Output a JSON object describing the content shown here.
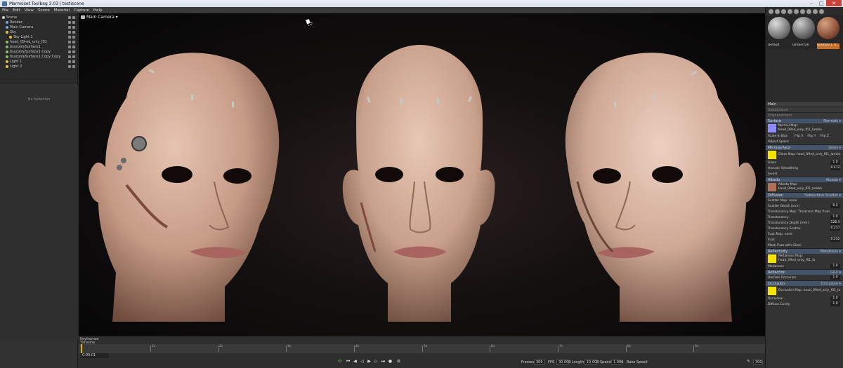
{
  "window": {
    "title": "Marmoset Toolbag 3.03 | testiscene"
  },
  "menu": [
    "File",
    "Edit",
    "View",
    "Scene",
    "Material",
    "Capture",
    "Help"
  ],
  "outliner": {
    "items": [
      {
        "label": "Scene",
        "indent": 0,
        "color": "#d0d0d0"
      },
      {
        "label": "Render",
        "indent": 1,
        "color": "#6fa8dc"
      },
      {
        "label": "Main Camera",
        "indent": 1,
        "color": "#6fa8dc"
      },
      {
        "label": "Sky",
        "indent": 1,
        "color": "#e6c14a"
      },
      {
        "label": "Sky Light 1",
        "indent": 2,
        "color": "#e6c14a"
      },
      {
        "label": "head_09-ed_only_f01",
        "indent": 1,
        "color": "#8fbf6a"
      },
      {
        "label": "bsurpolySurface1",
        "indent": 1,
        "color": "#8fbf6a"
      },
      {
        "label": "bsurpolySurface1 Copy",
        "indent": 1,
        "color": "#8fbf6a"
      },
      {
        "label": "bsurpolySurface1 Copy Copy",
        "indent": 1,
        "color": "#8fbf6a"
      },
      {
        "label": "Light 1",
        "indent": 1,
        "color": "#e6c14a"
      },
      {
        "label": "Light 2",
        "indent": 1,
        "color": "#e6c14a"
      }
    ],
    "empty_label": "No Selection"
  },
  "viewport": {
    "camera_label": "Main Camera ▾"
  },
  "timeline": {
    "keyframes_label": "Keyframes",
    "timeline_label": "Timeline",
    "timecode": "0:00.01",
    "frames_label": "Frames",
    "frames_value": "300",
    "fps_label": "FPS",
    "fps_value": "30.000",
    "length_label": "Length",
    "length_value": "10.000",
    "speed_label": "Speed",
    "speed_value": "1.000",
    "bake_label": "Bake Speed",
    "end_frame": "300"
  },
  "materials": {
    "names": [
      "Default",
      "lambert26",
      "Untitled 1 Tr..."
    ]
  },
  "inspector": {
    "main": "Main",
    "subdivision": "Subdivision",
    "displacement": "Displacement",
    "surface": {
      "title": "Surface",
      "mode": "Normals ▾",
      "normal_map": "Normal Map: head_09ed_only_f01_lambe",
      "scale_bias": "Scale & Bias",
      "flip_x": "Flip X",
      "flip_y": "Flip Y",
      "flip_z": "Flip Z",
      "object_space": "Object Space"
    },
    "microsurface": {
      "title": "Microsurface",
      "mode": "Gloss ▾",
      "map": "Gloss Map: head_09ed_only_f01_lambe",
      "channel": "Channel ▾ G",
      "gloss_label": "Gloss",
      "gloss_value": "1.0",
      "horizon_label": "Horizon Smoothing",
      "horizon_value": "0.412",
      "invert": "Invert"
    },
    "albedo": {
      "title": "Albedo",
      "mode": "Albedo ▾",
      "map": "Albedo Map: head_09ed_only_f01_lambe",
      "color": "Color"
    },
    "diffusion": {
      "title": "Diffusion",
      "mode": "Subsurface Scatter ▾",
      "scatter_map": "Scatter Map: none",
      "scatter_depth_label": "Scatter Depth (mm)",
      "scatter_depth_value": "6.4",
      "trans_map": "Translucency Map: Thickness Map from",
      "translucency_label": "Translucency",
      "translucency_value": "1.0",
      "trans_depth_label": "Translucency Depth (mm)",
      "trans_depth_value": "128.4",
      "trans_scatter_label": "Translucency Scatter",
      "trans_scatter_value": "0.237",
      "fuzz_map": "Fuzz Map: none",
      "fuzz_label": "Fuzz",
      "fuzz_value": "0.232",
      "mask_fuzz": "Mask Fuzz with Gloss"
    },
    "reflectivity": {
      "title": "Reflectivity",
      "mode": "Metalness ▾",
      "map": "Metalness Map: head_09ed_only_f01_la",
      "channel": "Channel ▾ R",
      "metalness_label": "Metalness",
      "metalness_value": "1.0",
      "invert": "Invert"
    },
    "reflection": {
      "title": "Reflection",
      "mode": "GGX ▾",
      "horizon_label": "Horizon Occlusion",
      "horizon_value": "1.0",
      "secondary": "Secondary Reflection"
    },
    "occlusion": {
      "title": "Occlusion",
      "mode": "Occlusion ▾",
      "map": "Occlusion Map: head_09ed_only_f01_la",
      "channel": "Channel ▾ R",
      "occlusion_label": "Occlusion",
      "occlusion_value": "1.0",
      "uv_set": "UV Set ▾",
      "vertex_channel": "Vertex Channel ▾",
      "cavity_map": "Cavity Map: none",
      "cavity_channel": "Channel ▾ R",
      "diffuse_cavity_label": "Diffuse Cavity",
      "diffuse_cavity_value": "1.0",
      "specular_cavity_label": "Specular Cavity",
      "specular_cavity_value": "1.0"
    }
  },
  "colors": {
    "accent": "#e0b400",
    "selected_material": "#c46f2a",
    "map_yellow": "#f5e400",
    "normal_blue": "#8c8cff"
  }
}
